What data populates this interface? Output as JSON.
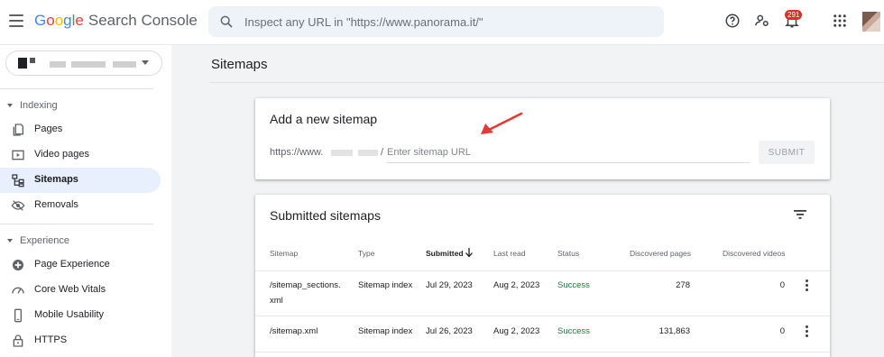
{
  "app": {
    "logo_google": [
      "G",
      "o",
      "o",
      "g",
      "l",
      "e"
    ],
    "product_name": "Search Console"
  },
  "search": {
    "placeholder": "Inspect any URL in \"https://www.panorama.it/\""
  },
  "notifications": {
    "count": "291"
  },
  "sidebar": {
    "sections": [
      {
        "label": "Indexing",
        "items": [
          "Pages",
          "Video pages",
          "Sitemaps",
          "Removals"
        ]
      },
      {
        "label": "Experience",
        "items": [
          "Page Experience",
          "Core Web Vitals",
          "Mobile Usability",
          "HTTPS"
        ]
      }
    ],
    "active_item": "Sitemaps"
  },
  "page": {
    "title": "Sitemaps"
  },
  "add_sitemap": {
    "title": "Add a new sitemap",
    "url_prefix": "https://www.",
    "url_slash": "/",
    "input_placeholder": "Enter sitemap URL",
    "submit_label": "SUBMIT"
  },
  "submitted": {
    "title": "Submitted sitemaps",
    "columns": [
      "Sitemap",
      "Type",
      "Submitted",
      "Last read",
      "Status",
      "Discovered pages",
      "Discovered videos"
    ],
    "sorted_column": "Submitted",
    "rows": [
      {
        "sitemap_line1": "/sitemap_sections.",
        "sitemap_line2": "xml",
        "type": "Sitemap index",
        "submitted": "Jul 29, 2023",
        "last_read": "Aug 2, 2023",
        "status": "Success",
        "pages": "278",
        "videos": "0"
      },
      {
        "sitemap_line1": "/sitemap.xml",
        "sitemap_line2": "",
        "type": "Sitemap index",
        "submitted": "Jul 26, 2023",
        "last_read": "Aug 2, 2023",
        "status": "Success",
        "pages": "131,863",
        "videos": "0"
      }
    ]
  },
  "colors": {
    "accent": "#1a73e8",
    "active_bg": "#e8f0fe",
    "success": "#188038",
    "annotation_arrow": "#e53935"
  },
  "icons": [
    "menu-icon",
    "search-icon",
    "help-icon",
    "users-settings-icon",
    "bell-icon",
    "apps-icon",
    "pages-icon",
    "video-pages-icon",
    "sitemaps-icon",
    "removals-icon",
    "page-experience-icon",
    "core-web-vitals-icon",
    "mobile-usability-icon",
    "https-lock-icon",
    "filter-icon",
    "sort-arrow-icon",
    "more-vert-icon",
    "annotation-arrow"
  ]
}
